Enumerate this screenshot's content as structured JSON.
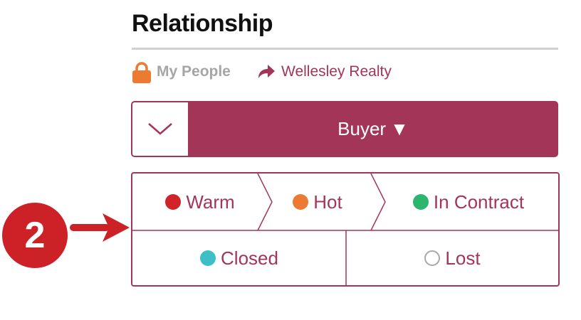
{
  "section": {
    "title": "Relationship"
  },
  "meta": {
    "lock_icon": "lock-icon",
    "visibility_label": "My People",
    "share_icon": "share-arrow-icon",
    "agency_label": "Wellesley Realty"
  },
  "stage": {
    "collapse_icon": "chevron-down-icon",
    "selected": "Buyer",
    "caret": "▼"
  },
  "statuses": [
    {
      "label": "Warm",
      "color": "#d1232a"
    },
    {
      "label": "Hot",
      "color": "#ec7a31"
    },
    {
      "label": "In Contract",
      "color": "#2bb56d"
    },
    {
      "label": "Closed",
      "color": "#3ebfc7"
    },
    {
      "label": "Lost",
      "color": "hollow"
    }
  ],
  "callout": {
    "number": "2"
  },
  "colors": {
    "accent": "#a33658",
    "muted": "#a6a6a6",
    "callout": "#cc2127",
    "rule": "#d0d0d0"
  }
}
